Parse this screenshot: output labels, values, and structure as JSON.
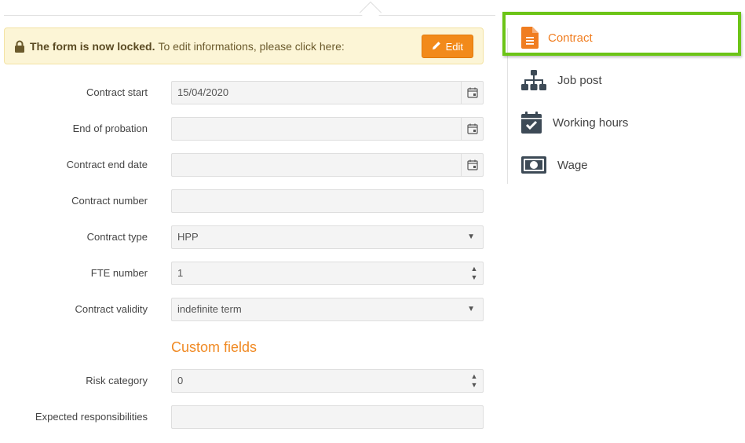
{
  "banner": {
    "locked_bold": "The form is now locked.",
    "locked_text": "To edit informations, please click here:",
    "edit_label": "Edit"
  },
  "form": {
    "contract_start": {
      "label": "Contract start",
      "value": "15/04/2020"
    },
    "end_of_probation": {
      "label": "End of probation",
      "value": ""
    },
    "contract_end_date": {
      "label": "Contract end date",
      "value": ""
    },
    "contract_number": {
      "label": "Contract number",
      "value": ""
    },
    "contract_type": {
      "label": "Contract type",
      "value": "HPP"
    },
    "fte_number": {
      "label": "FTE number",
      "value": "1"
    },
    "contract_validity": {
      "label": "Contract validity",
      "value": "indefinite term"
    }
  },
  "custom_fields": {
    "title": "Custom fields",
    "risk_category": {
      "label": "Risk category",
      "value": "0"
    },
    "expected_responsibilities": {
      "label": "Expected responsibilities",
      "value": ""
    }
  },
  "sidebar": {
    "items": [
      {
        "label": "Contract",
        "icon": "document-icon",
        "active": true
      },
      {
        "label": "Job post",
        "icon": "org-chart-icon",
        "active": false
      },
      {
        "label": "Working hours",
        "icon": "calendar-check-icon",
        "active": false
      },
      {
        "label": "Wage",
        "icon": "banknote-icon",
        "active": false
      }
    ]
  },
  "colors": {
    "accent": "#f07d20",
    "edit_button": "#f28a1a",
    "banner_bg": "#fcf5d6",
    "highlight": "#6cc417",
    "icon": "#3d4a56"
  }
}
